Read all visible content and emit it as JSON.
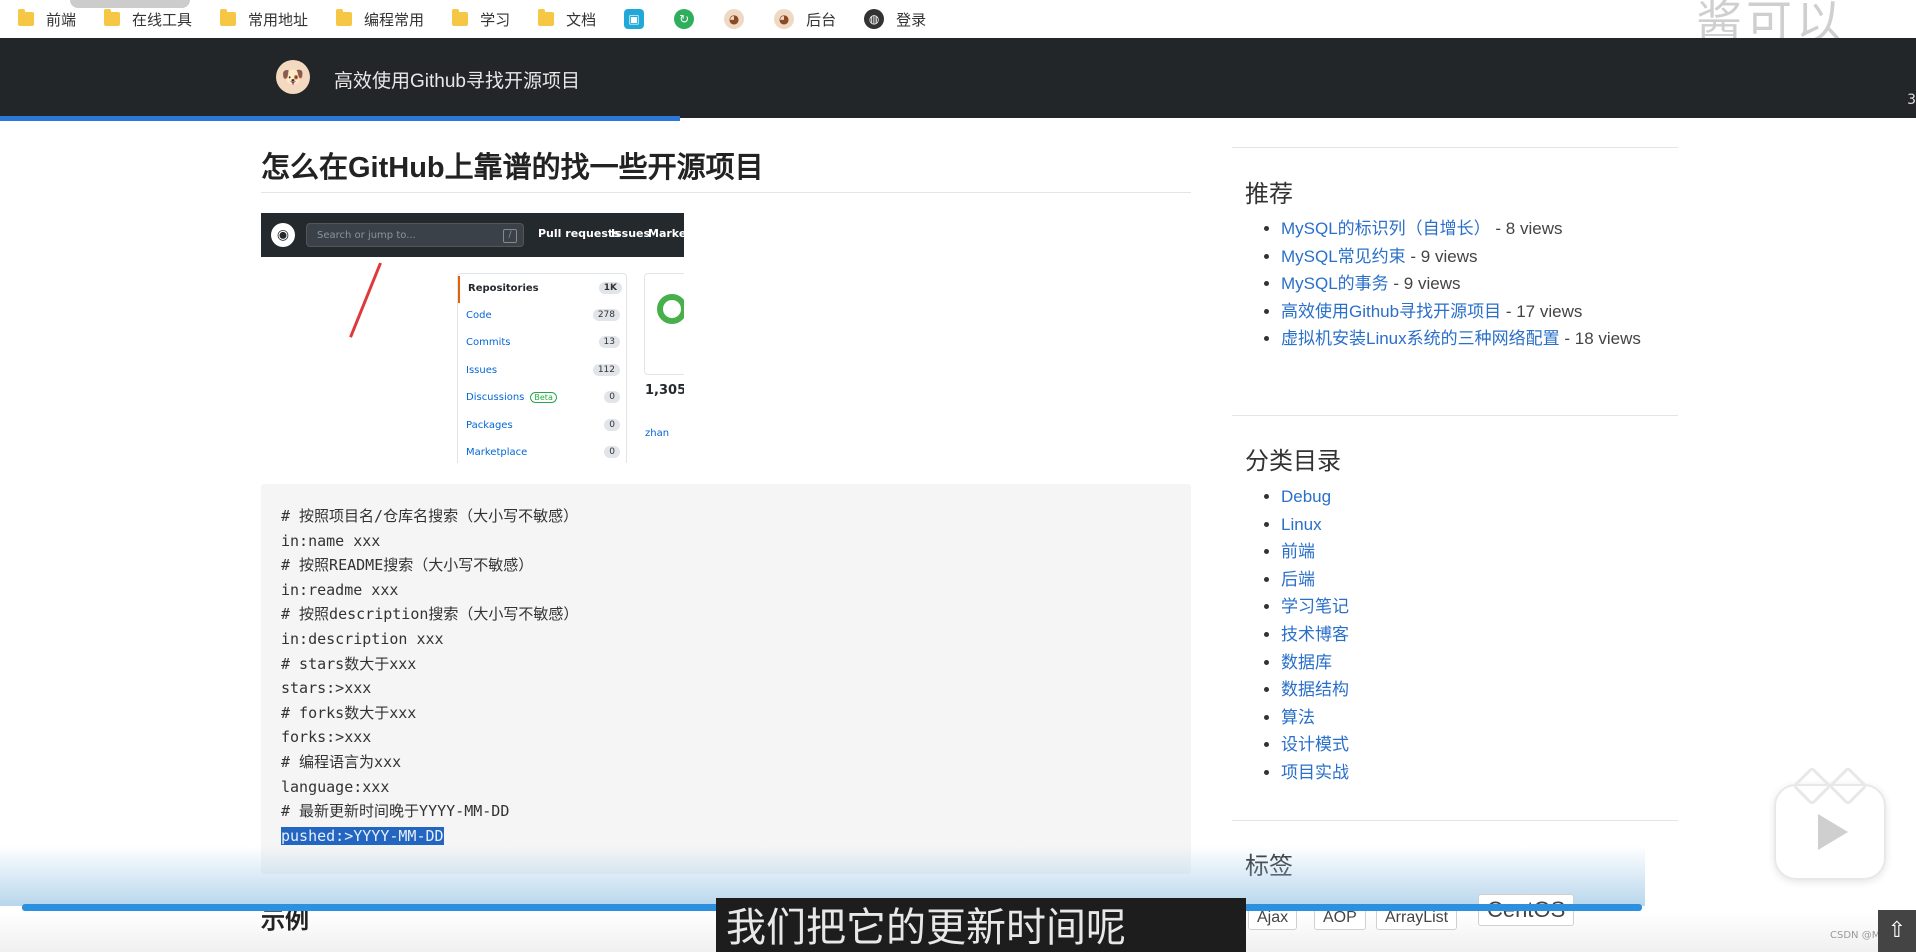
{
  "bookmarks": [
    {
      "label": "前端",
      "icon": "folder-icon"
    },
    {
      "label": "在线工具",
      "icon": "folder-icon"
    },
    {
      "label": "常用地址",
      "icon": "folder-icon"
    },
    {
      "label": "编程常用",
      "icon": "folder-icon"
    },
    {
      "label": "学习",
      "icon": "folder-icon"
    },
    {
      "label": "文档",
      "icon": "folder-icon"
    }
  ],
  "bookmark_icons": {
    "backend_label": "后台",
    "login_label": "登录"
  },
  "watermark_top": "酱可以",
  "navbar": {
    "title": "高效使用Github寻找开源项目",
    "right_text": "3"
  },
  "post": {
    "title": "怎么在GitHub上靠谱的找一些开源项目"
  },
  "github_shot": {
    "search_placeholder": "Search or jump to...",
    "slash": "/",
    "nav": [
      "Pull requests",
      "Issues",
      "Marketp"
    ],
    "menu": [
      {
        "label": "Repositories",
        "count": "1K"
      },
      {
        "label": "Code",
        "count": "278"
      },
      {
        "label": "Commits",
        "count": "13"
      },
      {
        "label": "Issues",
        "count": "112"
      },
      {
        "label": "Discussions",
        "count": "0",
        "badge": "Beta"
      },
      {
        "label": "Packages",
        "count": "0"
      },
      {
        "label": "Marketplace",
        "count": "0"
      }
    ],
    "result_count": "1,305",
    "user_link": "zhan"
  },
  "code_lines": [
    "# 按照项目名/仓库名搜索（大小写不敏感）",
    "in:name xxx",
    "# 按照README搜索（大小写不敏感）",
    "in:readme xxx",
    "# 按照description搜索（大小写不敏感）",
    "in:description xxx",
    "# stars数大于xxx",
    "stars:>xxx",
    "# forks数大于xxx",
    "forks:>xxx",
    "# 编程语言为xxx",
    "language:xxx",
    "# 最新更新时间晚于YYYY-MM-DD"
  ],
  "code_last_line": "pushed:>YYYY-MM-DD",
  "sidebar": {
    "recommend_title": "推荐",
    "recommend": [
      {
        "title": "MySQL的标识列（自增长）",
        "views": " - 8 views"
      },
      {
        "title": "MySQL常见约束",
        "views": " - 9 views"
      },
      {
        "title": "MySQL的事务",
        "views": " - 9 views"
      },
      {
        "title": "高效使用Github寻找开源项目",
        "views": " - 17 views"
      },
      {
        "title": "虚拟机安装Linux系统的三种网络配置",
        "views": " - 18 views"
      }
    ],
    "category_title": "分类目录",
    "categories": [
      "Debug",
      "Linux",
      "前端",
      "后端",
      "学习笔记",
      "技术博客",
      "数据库",
      "数据结构",
      "算法",
      "设计模式",
      "项目实战"
    ],
    "tags_title": "标签",
    "tags": [
      "Ajax",
      "AOP",
      "ArrayList",
      "CentOS"
    ]
  },
  "video": {
    "example_heading": "示例",
    "subtitle": "我们把它的更新时间呢",
    "credit": "CSDN @Micel",
    "progress": 1.0
  }
}
